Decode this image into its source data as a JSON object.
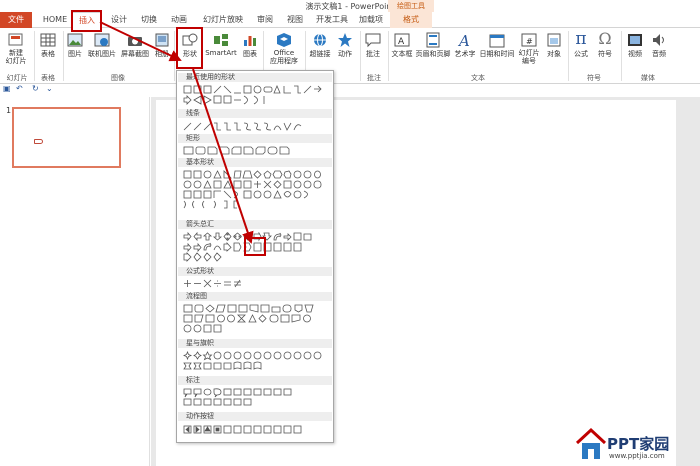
{
  "window": {
    "title": "演示文稿1 - PowerPoint"
  },
  "tabs": [
    {
      "label": "文件"
    },
    {
      "label": "HOME"
    },
    {
      "label": "插入"
    },
    {
      "label": "设计"
    },
    {
      "label": "切换"
    },
    {
      "label": "动画"
    },
    {
      "label": "幻灯片放映"
    },
    {
      "label": "审阅"
    },
    {
      "label": "视图"
    },
    {
      "label": "开发工具"
    },
    {
      "label": "加载项"
    },
    {
      "label": "格式"
    }
  ],
  "context_tab_group": "绘图工具",
  "ribbon": {
    "new_slide": "新建\n幻灯片",
    "table": "表格",
    "picture": "图片",
    "online_picture": "联机图片",
    "screenshot": "屏幕截图",
    "album": "相册",
    "shapes": "形状",
    "smartart": "SmartArt",
    "chart": "图表",
    "office_apps": "Office\n应用程序",
    "hyperlink": "超链接",
    "action": "动作",
    "comment": "批注",
    "textbox": "文本框",
    "header_footer": "页眉和页脚",
    "wordart": "艺术字",
    "datetime": "日期和时间",
    "slide_number": "幻灯片\n编号",
    "object": "对象",
    "equation": "公式",
    "symbol": "符号",
    "video": "视频",
    "audio": "音频",
    "groups": {
      "slides": "幻灯片",
      "tables": "表格",
      "images": "图像",
      "comments": "批注",
      "text": "文本",
      "symbols": "符号",
      "media": "媒体"
    }
  },
  "slide_panel": {
    "slide_number": "1"
  },
  "shapes_menu": {
    "sections": [
      "最近使用的形状",
      "线条",
      "矩形",
      "基本形状",
      "箭头总汇",
      "公式形状",
      "流程图",
      "星与旗帜",
      "标注",
      "动作按钮"
    ]
  },
  "watermark": {
    "brand": "PPT家园",
    "url": "www.pptjia.com"
  },
  "colors": {
    "accent": "#d24726",
    "highlight": "#c00000"
  }
}
